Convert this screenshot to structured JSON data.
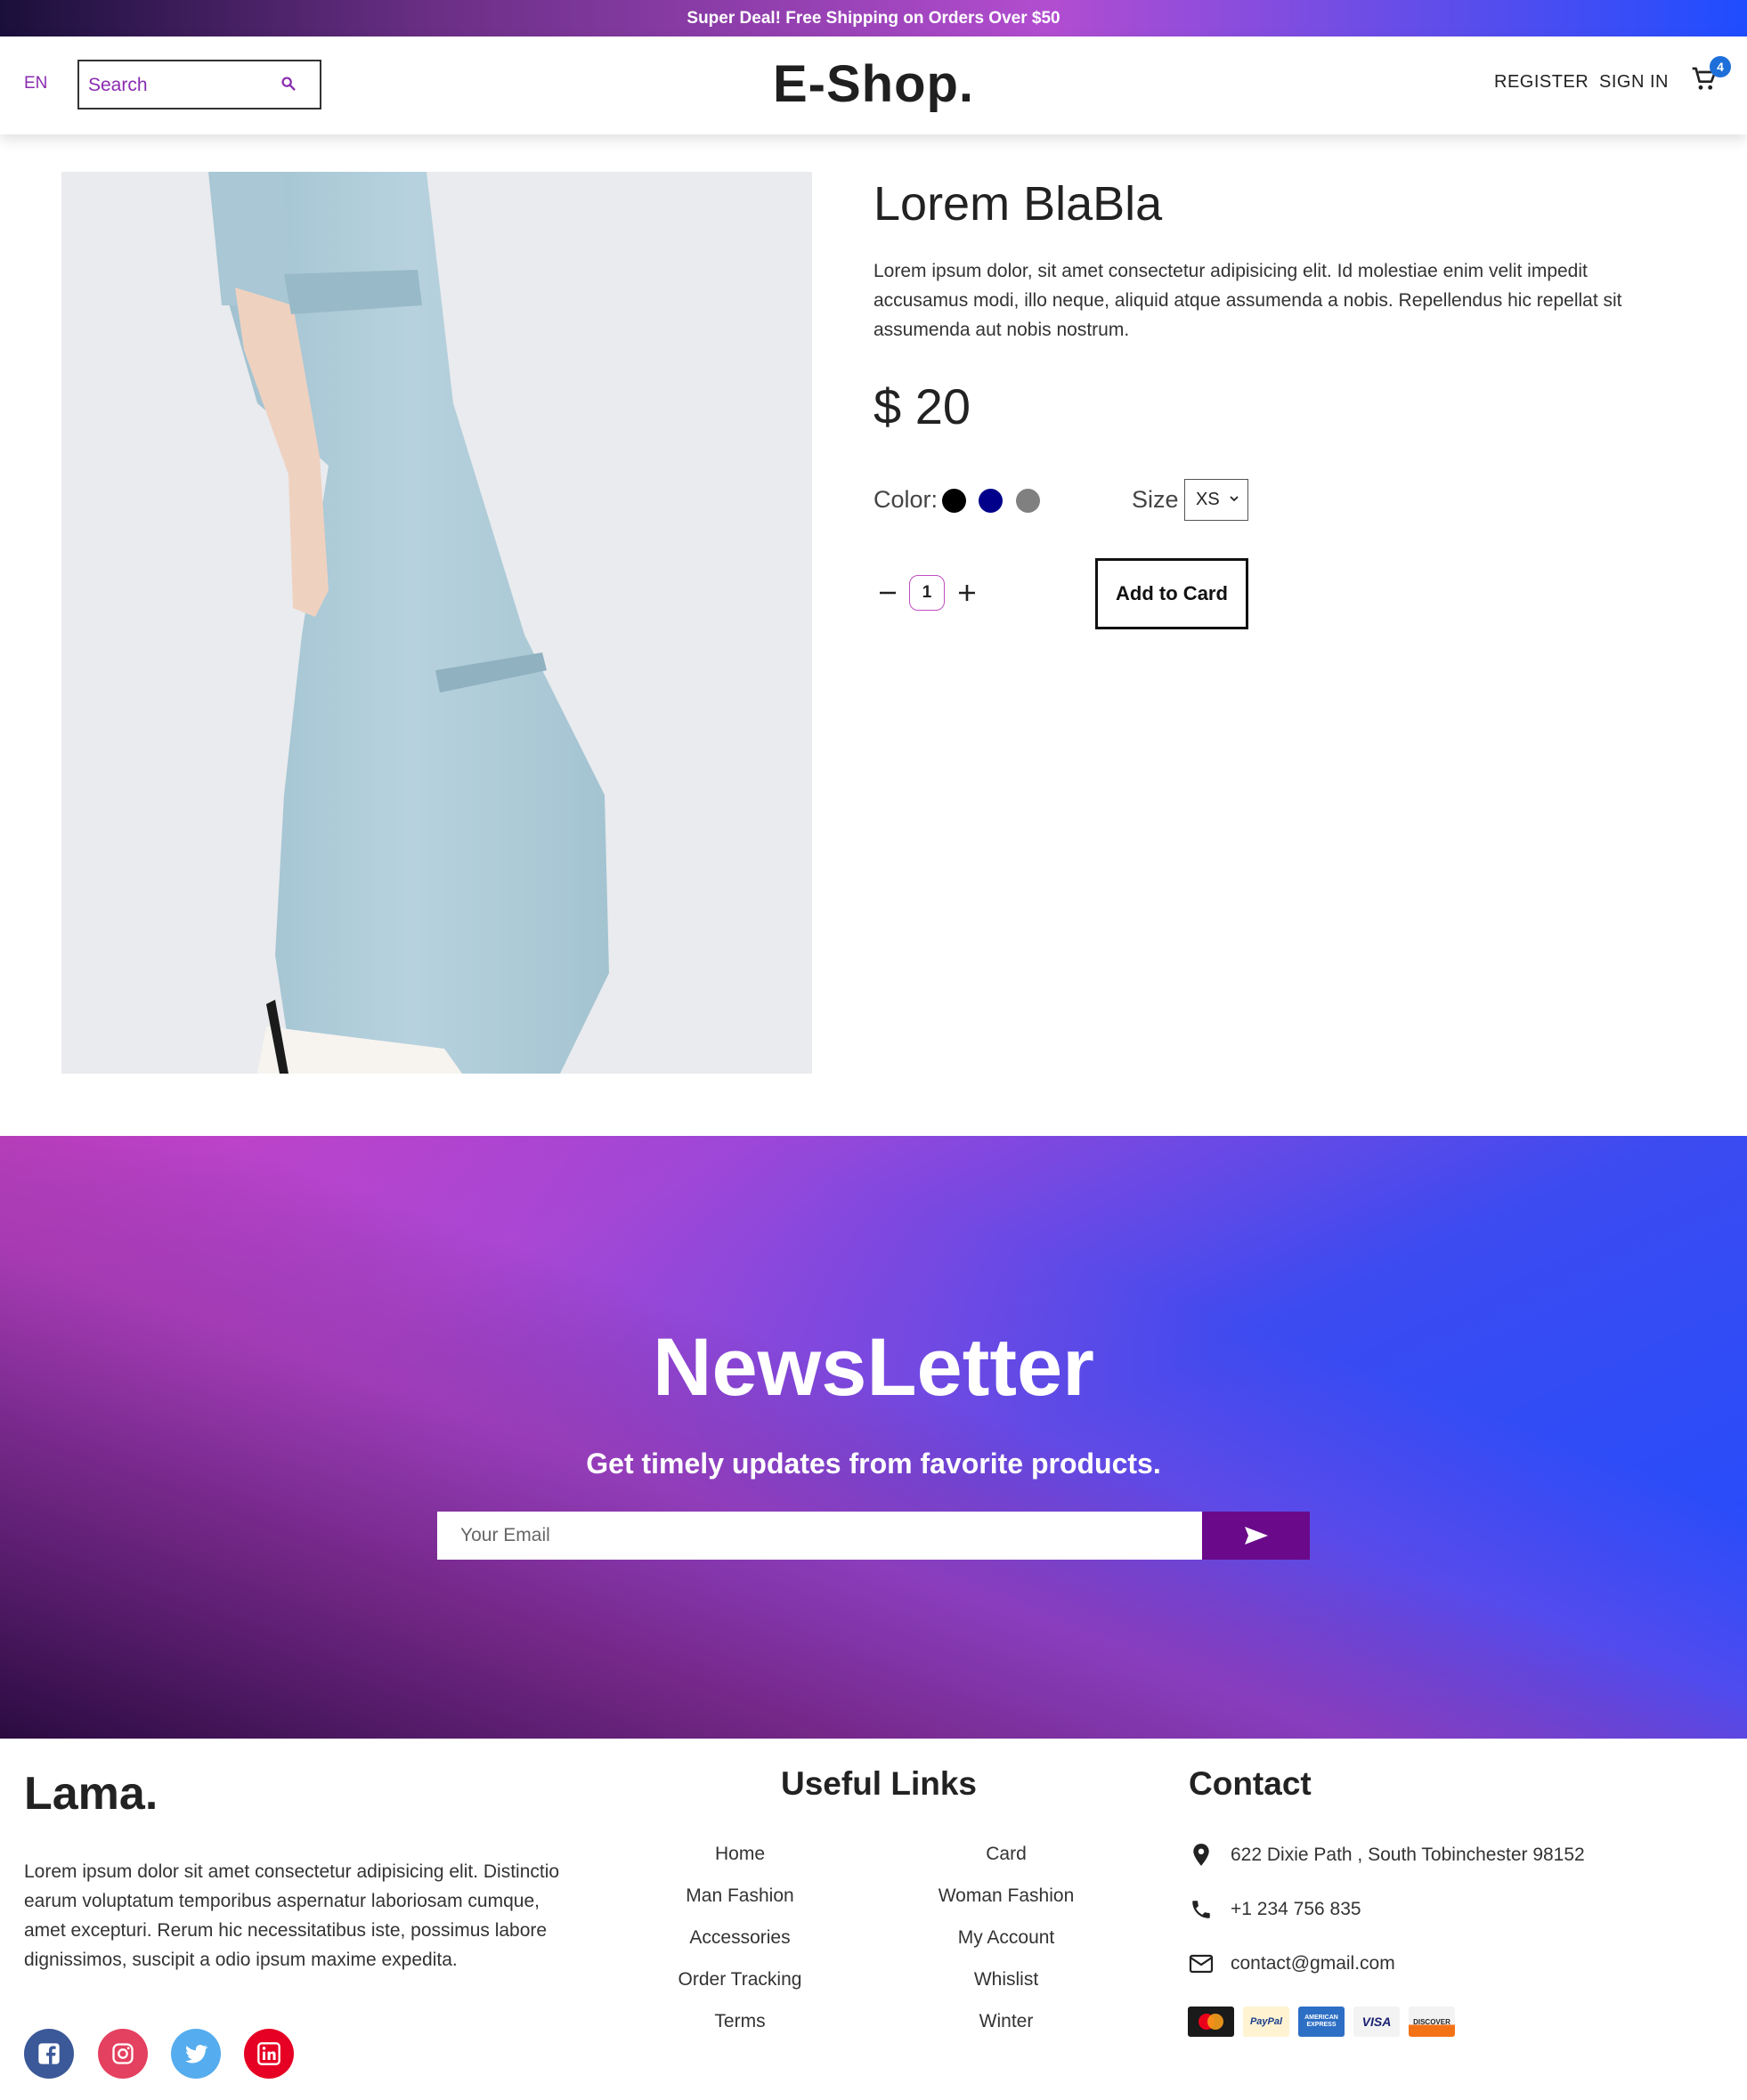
{
  "announcement": "Super Deal! Free Shipping on Orders Over $50",
  "header": {
    "language": "EN",
    "search_placeholder": "Search",
    "brand": "E-Shop.",
    "register": "REGISTER",
    "sign_in": "SIGN IN",
    "cart_count": "4"
  },
  "product": {
    "title": "Lorem BlaBla",
    "description": "Lorem ipsum dolor, sit amet consectetur adipisicing elit. Id molestiae enim velit impedit accusamus modi, illo neque, aliquid atque assumenda a nobis. Repellendus hic repellat sit assumenda aut nobis nostrum.",
    "price": "$ 20",
    "color_label": "Color:",
    "colors": [
      "#000000",
      "#00008b",
      "#808080"
    ],
    "size_label": "Size",
    "size_selected": "XS",
    "quantity": "1",
    "add_button": "Add to Card"
  },
  "newsletter": {
    "title": "NewsLetter",
    "subtitle": "Get timely updates from favorite products.",
    "email_placeholder": "Your Email"
  },
  "footer": {
    "brand": "Lama.",
    "description": "Lorem ipsum dolor sit amet consectetur adipisicing elit. Distinctio earum voluptatum temporibus aspernatur laboriosam cumque, amet excepturi. Rerum hic necessitatibus iste, possimus labore dignissimos, suscipit a odio ipsum maxime expedita.",
    "useful_links_title": "Useful Links",
    "links_left": [
      "Home",
      "Man Fashion",
      "Accessories",
      "Order Tracking",
      "Terms"
    ],
    "links_right": [
      "Card",
      "Woman Fashion",
      "My Account",
      "Whislist",
      "Winter"
    ],
    "contact_title": "Contact",
    "address": "622 Dixie Path , South Tobinchester 98152",
    "phone": "+1 234 756 835",
    "email": "contact@gmail.com",
    "payment_labels": [
      "MasterCard",
      "PayPal",
      "AMERICAN EXPRESS",
      "VISA",
      "DISCOVER"
    ],
    "social_colors": [
      "#3b5998",
      "#e4405f",
      "#55acee",
      "#e60023"
    ],
    "social_icons": [
      "facebook-icon",
      "instagram-icon",
      "twitter-icon",
      "linkedin-icon"
    ]
  }
}
